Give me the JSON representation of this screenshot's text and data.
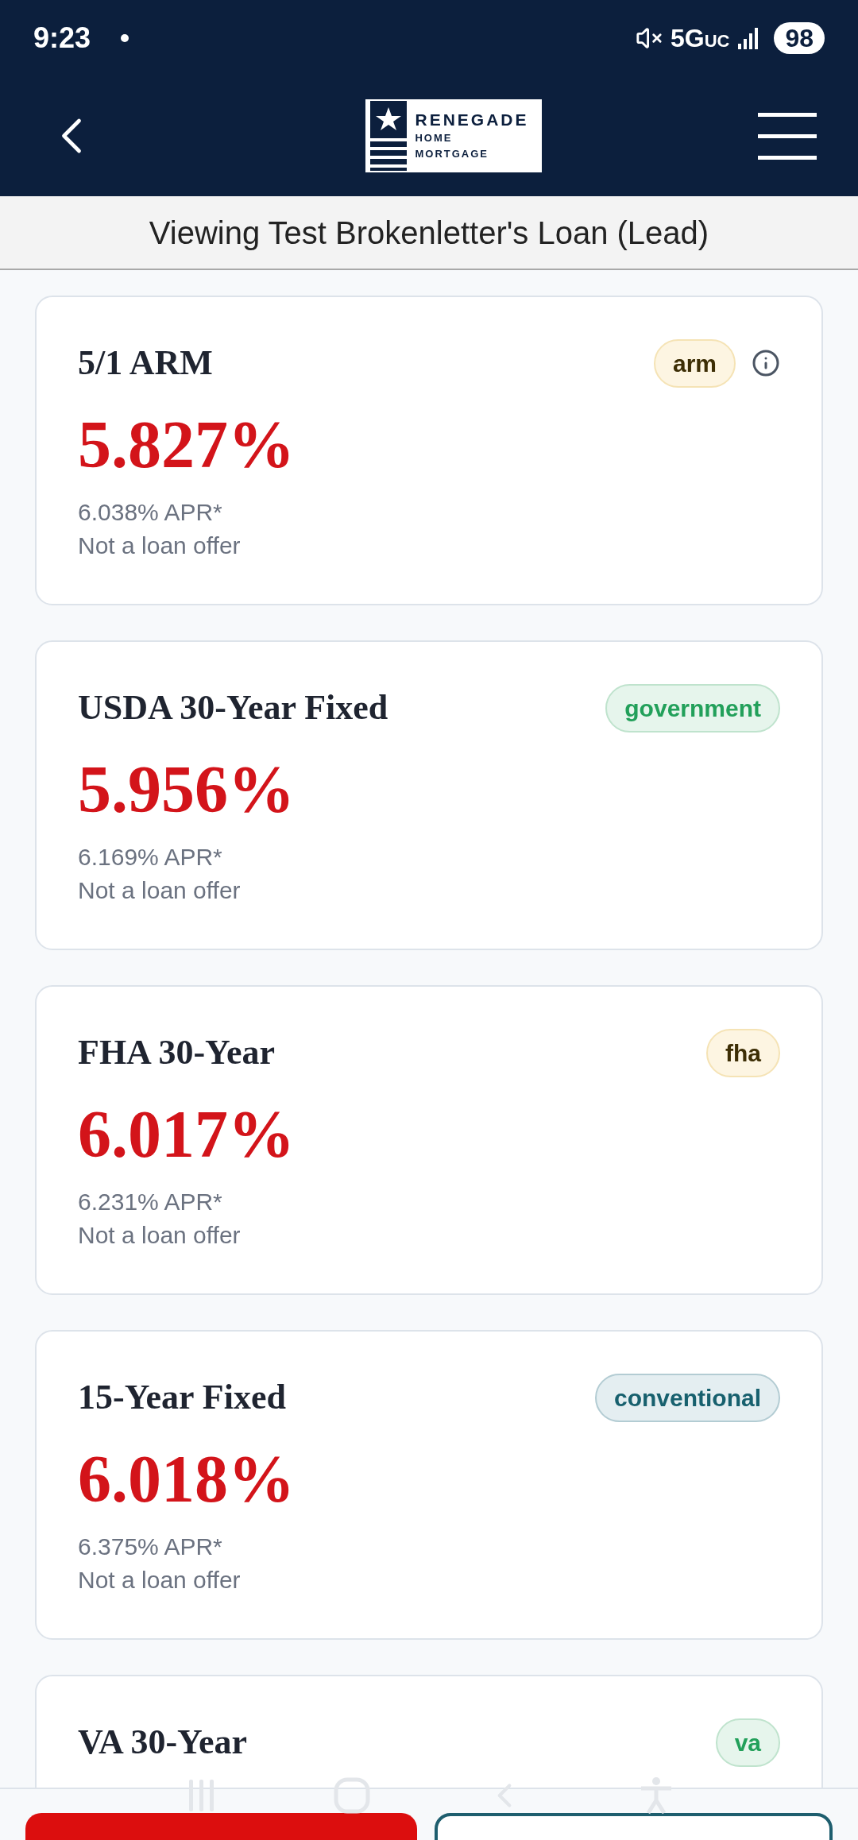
{
  "status_bar": {
    "time": "9:23",
    "network": "5G",
    "network_suffix": "UC",
    "battery": "98"
  },
  "header": {
    "logo": {
      "name": "RENEGADE",
      "line_2": "HOME",
      "line_3": "MORTGAGE"
    }
  },
  "subheader": {
    "title": "Viewing Test Brokenletter's Loan (Lead)"
  },
  "loans": [
    {
      "title": "5/1 ARM",
      "badge": {
        "label": "arm",
        "color": "#fdf5e2"
      },
      "info": true,
      "rate": "5.827%",
      "apr": "6.038% APR*",
      "note": "Not a loan offer"
    },
    {
      "title": "USDA 30-Year Fixed",
      "badge": {
        "label": "government",
        "color": "#e6f5ec"
      },
      "info": false,
      "rate": "5.956%",
      "apr": "6.169% APR*",
      "note": "Not a loan offer"
    },
    {
      "title": "FHA 30-Year",
      "badge": {
        "label": "fha",
        "color": "#fdf5e2"
      },
      "info": false,
      "rate": "6.017%",
      "apr": "6.231% APR*",
      "note": "Not a loan offer"
    },
    {
      "title": "15-Year Fixed",
      "badge": {
        "label": "conventional",
        "color": "#e4eef1"
      },
      "info": false,
      "rate": "6.018%",
      "apr": "6.375% APR*",
      "note": "Not a loan offer"
    },
    {
      "title": "VA 30-Year",
      "badge": {
        "label": "va",
        "color": "#e6f5ec"
      },
      "info": false
    }
  ],
  "actions": [
    {
      "kind": "primary"
    },
    {
      "kind": "secondary"
    }
  ]
}
